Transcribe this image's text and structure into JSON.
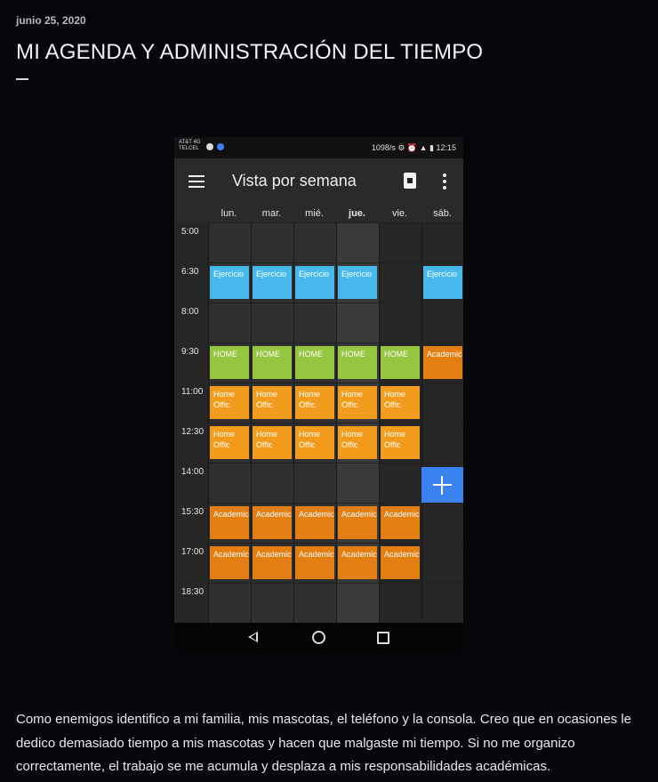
{
  "post": {
    "date": "junio 25, 2020",
    "title": "MI AGENDA Y ADMINISTRACIÓN DEL TIEMPO",
    "body": "Como enemigos identifico a mi familia, mis mascotas, el teléfono y la consola. Creo que en ocasiones le dedico demasiado tiempo a mis mascotas y hacen que malgaste mi tiempo. Si no me organizo correctamente, el trabajo se me acumula y desplaza a mis responsabilidades académicas."
  },
  "phone": {
    "status_bar": {
      "carrier": "AT&T 4G TELCEL",
      "right": "1098/s ⚙ ⏰ ▲ ▮ 12:15",
      "time": "12:15"
    },
    "app_bar": {
      "title": "Vista por semana",
      "icons": [
        "menu-icon",
        "calendar-today-icon",
        "more-vert-icon"
      ]
    },
    "days": [
      "lun.",
      "mar.",
      "mié.",
      "jue.",
      "vie.",
      "sáb."
    ],
    "times": [
      "5:00",
      "6:30",
      "8:00",
      "9:30",
      "11:00",
      "12:30",
      "14:00",
      "15:30",
      "17:00",
      "18:30"
    ],
    "events": [
      {
        "label": "Ejercicio",
        "color": "#46b9ea",
        "days": [
          0,
          1,
          2,
          3,
          5
        ],
        "time": "6:30"
      },
      {
        "label": "HOME",
        "color": "#94c640",
        "days": [
          0,
          1,
          2,
          3,
          4
        ],
        "time": "9:30"
      },
      {
        "label": "Academico",
        "color": "#e37e12",
        "days": [
          5
        ],
        "time": "9:30"
      },
      {
        "label": "Home Offic",
        "color": "#f39b1c",
        "days": [
          0,
          1,
          2,
          3,
          4
        ],
        "time": "11:00"
      },
      {
        "label": "Home Offic",
        "color": "#f39b1c",
        "days": [
          0,
          1,
          2,
          3,
          4
        ],
        "time": "12:30"
      },
      {
        "label": "Academico",
        "color": "#e37e12",
        "days": [
          0,
          1,
          2,
          3,
          4
        ],
        "time": "15:30"
      },
      {
        "label": "Academico",
        "color": "#e37e12",
        "days": [
          0,
          1,
          2,
          3,
          4
        ],
        "time": "17:00"
      }
    ],
    "fab_icon": "add-icon",
    "nav_icons": [
      "back-icon",
      "home-icon",
      "recents-icon"
    ]
  }
}
